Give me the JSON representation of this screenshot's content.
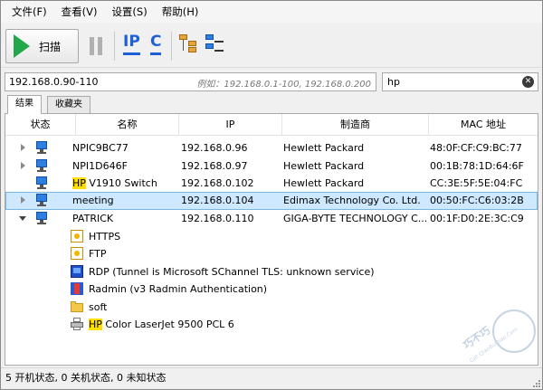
{
  "menu": [
    "文件(F)",
    "查看(V)",
    "设置(S)",
    "帮助(H)"
  ],
  "toolbar": {
    "scan_label": "扫描",
    "ip_label": "IP",
    "c_label": "C"
  },
  "address": {
    "value": "192.168.0.90-110",
    "hint": "例如：192.168.0.1-100, 192.168.0.200"
  },
  "search": {
    "value": "hp",
    "clear_glyph": "✕"
  },
  "tabs": [
    "结果",
    "收藏夹"
  ],
  "columns": [
    "状态",
    "名称",
    "IP",
    "制造商",
    "MAC 地址"
  ],
  "rows": [
    {
      "name": "NPIC9BC77",
      "ip": "192.168.0.96",
      "vendor": "Hewlett Packard",
      "mac": "48:0F:CF:C9:BC:77",
      "selected": false,
      "expanded": false
    },
    {
      "name": "NPI1D646F",
      "ip": "192.168.0.97",
      "vendor": "Hewlett Packard",
      "mac": "00:1B:78:1D:64:6F",
      "selected": false,
      "expanded": false
    },
    {
      "name_hl": "HP",
      "name_rest": " V1910 Switch",
      "ip": "192.168.0.102",
      "vendor": "Hewlett Packard",
      "mac": "CC:3E:5F:5E:04:FC",
      "selected": false,
      "expanded": null
    },
    {
      "name": "meeting",
      "ip": "192.168.0.104",
      "vendor": "Edimax Technology Co. Ltd.",
      "mac": "00:50:FC:C6:03:2B",
      "selected": true,
      "expanded": false
    },
    {
      "name": "PATRICK",
      "ip": "192.168.0.110",
      "vendor": "GIGA-BYTE TECHNOLOGY C...",
      "mac": "00:1F:D0:2E:3C:C9",
      "selected": false,
      "expanded": true
    }
  ],
  "services": [
    {
      "label": "HTTPS",
      "icon": "https-icon"
    },
    {
      "label": "FTP",
      "icon": "ftp-icon"
    },
    {
      "label": "RDP (Tunnel is Microsoft SChannel TLS: unknown service)",
      "icon": "rdp-icon"
    },
    {
      "label": "Radmin (v3 Radmin Authentication)",
      "icon": "radmin-icon"
    },
    {
      "label": "soft",
      "icon": "folder-icon"
    },
    {
      "label_hl": "HP",
      "label_rest": " Color LaserJet 9500 PCL 6",
      "icon": "printer-icon"
    }
  ],
  "status": "5 开机状态, 0 关机状态, 0 未知状态",
  "watermark": {
    "main": "巧不巧",
    "sub": "Get.QiaoBuQiao.Com"
  }
}
